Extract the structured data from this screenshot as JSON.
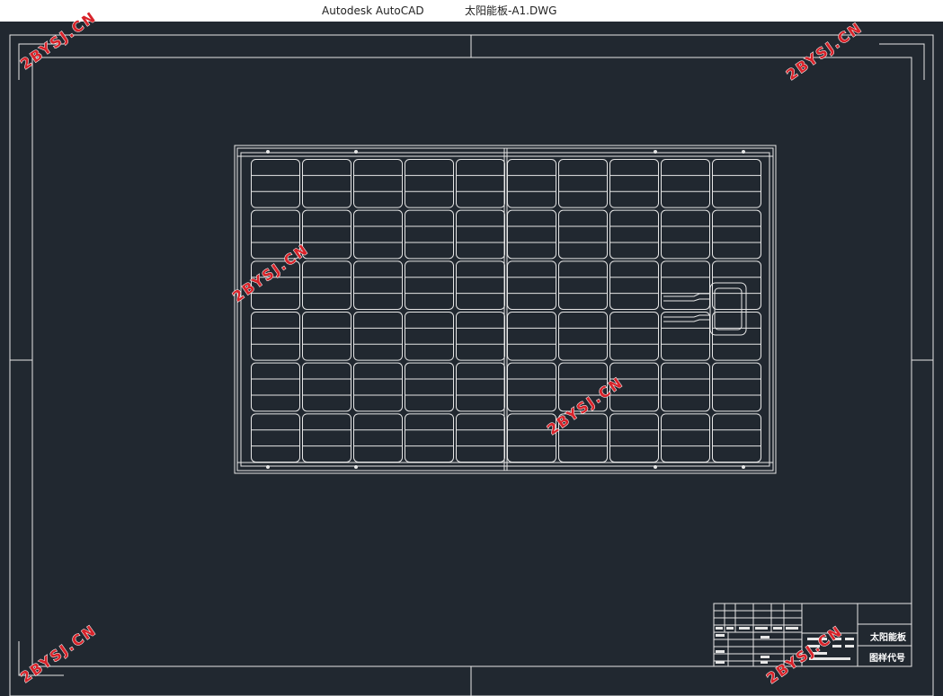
{
  "titlebar": {
    "app_name": "Autodesk AutoCAD",
    "document_name": "太阳能板-A1.DWG"
  },
  "drawing": {
    "panel": {
      "cell_columns": 10,
      "cell_rows": 6,
      "lines_per_cell": 3
    },
    "title_block": {
      "part_name": "太阳能板",
      "drawing_number_label": "图样代号"
    }
  },
  "watermark": {
    "text": "2BYSJ.CN"
  },
  "colors": {
    "canvas": "#212830",
    "line": "#e6e6e6",
    "watermark": "#d8232a"
  }
}
